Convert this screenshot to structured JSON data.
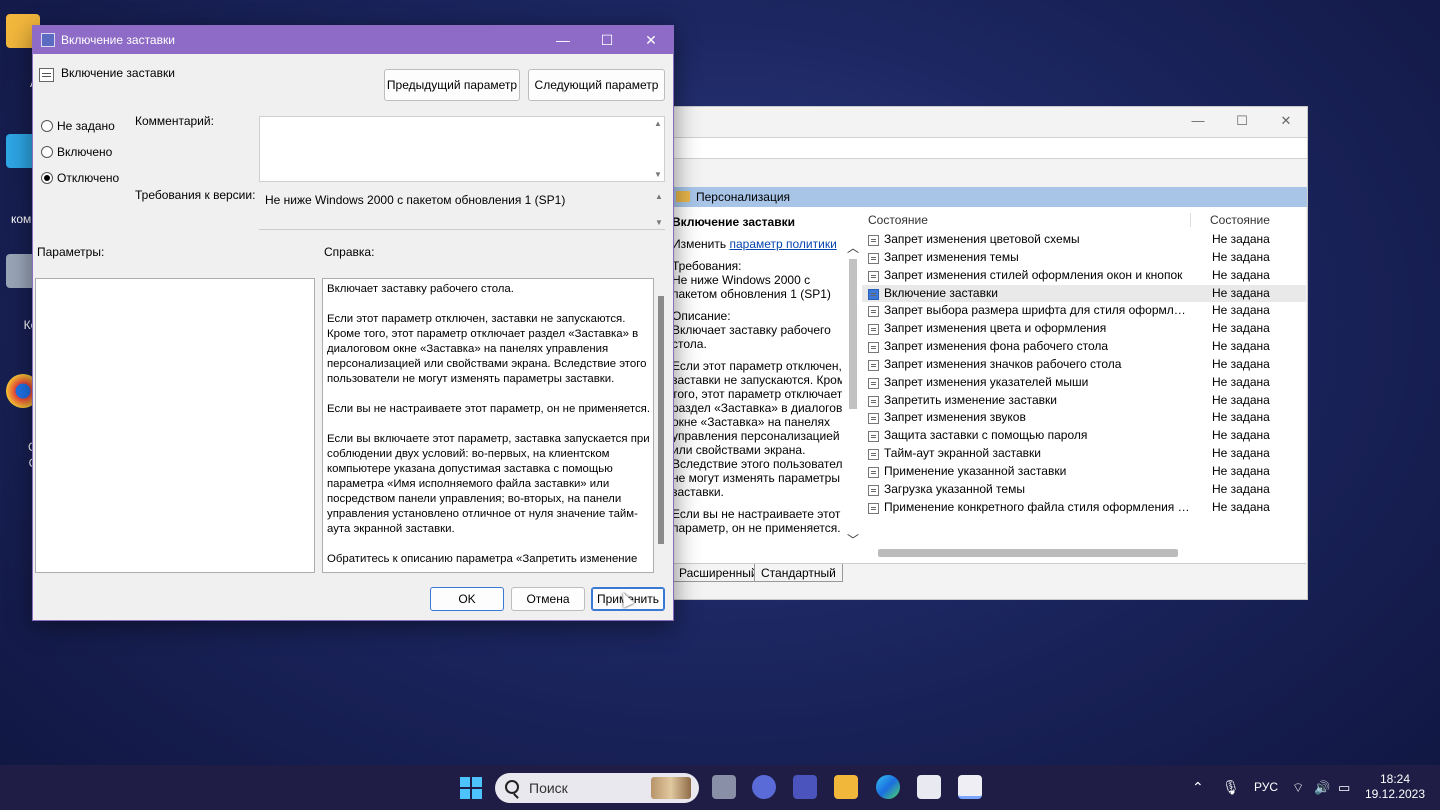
{
  "desktop": {
    "icons": [
      {
        "label": "Ac"
      },
      {
        "label": "Э"
      },
      {
        "label": "компь"
      },
      {
        "label": "Кор"
      },
      {
        "label": "Go"
      },
      {
        "label": "Ch"
      }
    ]
  },
  "bg_window": {
    "band_label": "Персонализация",
    "desc": {
      "title": "Включение заставки",
      "edit_prefix": "Изменить ",
      "edit_link": "параметр политики",
      "req_label": "Требования:",
      "req_line1": "Не ниже Windows 2000 с",
      "req_line2": "пакетом обновления 1 (SP1)",
      "desc_label": "Описание:",
      "desc_line1": "Включает заставку рабочего",
      "desc_line2": "стола.",
      "p1_l1": "Если этот параметр отключен,",
      "p1_l2": "заставки не запускаются. Кроме",
      "p1_l3": "того, этот параметр отключает",
      "p1_l4": "раздел «Заставка» в диалоговом",
      "p1_l5": "окне «Заставка» на панелях",
      "p1_l6": "управления персонализацией",
      "p1_l7": "или свойствами экрана.",
      "p1_l8": "Вследствие этого пользователи",
      "p1_l9": "не могут изменять параметры",
      "p1_l10": "заставки.",
      "p2_l1": "Если вы не настраиваете этот",
      "p2_l2": "параметр, он не применяется."
    },
    "columns": {
      "name": "Состояние",
      "state": "Состояние"
    },
    "rows": [
      {
        "name": "Запрет изменения цветовой схемы",
        "state": "Не задана"
      },
      {
        "name": "Запрет изменения темы",
        "state": "Не задана"
      },
      {
        "name": "Запрет изменения стилей оформления окон и кнопок",
        "state": "Не задана"
      },
      {
        "name": "Включение заставки",
        "state": "Не задана"
      },
      {
        "name": "Запрет выбора размера шрифта для стиля оформления",
        "state": "Не задана"
      },
      {
        "name": "Запрет изменения цвета и оформления",
        "state": "Не задана"
      },
      {
        "name": "Запрет изменения фона рабочего стола",
        "state": "Не задана"
      },
      {
        "name": "Запрет изменения значков рабочего стола",
        "state": "Не задана"
      },
      {
        "name": "Запрет изменения указателей мыши",
        "state": "Не задана"
      },
      {
        "name": "Запретить изменение заставки",
        "state": "Не задана"
      },
      {
        "name": "Запрет изменения звуков",
        "state": "Не задана"
      },
      {
        "name": "Защита заставки с помощью пароля",
        "state": "Не задана"
      },
      {
        "name": "Тайм-аут экранной заставки",
        "state": "Не задана"
      },
      {
        "name": "Применение указанной заставки",
        "state": "Не задана"
      },
      {
        "name": "Загрузка указанной темы",
        "state": "Не задана"
      },
      {
        "name": "Применение конкретного файла стиля оформления или к...",
        "state": "Не задана"
      }
    ],
    "selected_row": 3,
    "tabs": {
      "extended": "Расширенный",
      "standard": "Стандартный"
    }
  },
  "dialog": {
    "title": "Включение заставки",
    "policy_name": "Включение заставки",
    "prev_button": "Предыдущий параметр",
    "next_button": "Следующий параметр",
    "radios": [
      {
        "label": "Не задано",
        "checked": false
      },
      {
        "label": "Включено",
        "checked": false
      },
      {
        "label": "Отключено",
        "checked": true
      }
    ],
    "comment_label": "Комментарий:",
    "comment_value": "",
    "requirements_label": "Требования к версии:",
    "requirements_value": "Не ниже Windows 2000 с пакетом обновления 1 (SP1)",
    "options_label": "Параметры:",
    "help_label": "Справка:",
    "help_text": "Включает заставку рабочего стола.\n\nЕсли этот параметр отключен, заставки не запускаются. Кроме того, этот параметр отключает раздел «Заставка» в диалоговом окне «Заставка» на панелях управления персонализацией или свойствами экрана. Вследствие этого пользователи не могут изменять параметры заставки.\n\nЕсли вы не настраиваете этот параметр, он не применяется.\n\nЕсли вы включаете этот параметр, заставка запускается при соблюдении двух условий: во-первых, на клиентском компьютере указана допустимая заставка с помощью параметра «Имя исполняемого файла заставки» или посредством панели управления; во-вторых, на панели управления установлено отличное от нуля значение тайм-аута экранной заставки.\n\nОбратитесь к описанию параметра «Запретить изменение",
    "ok_button": "OK",
    "cancel_button": "Отмена",
    "apply_button": "Применить"
  },
  "taskbar": {
    "search_placeholder": "Поиск",
    "language": "РУС",
    "time": "18:24",
    "date": "19.12.2023"
  }
}
